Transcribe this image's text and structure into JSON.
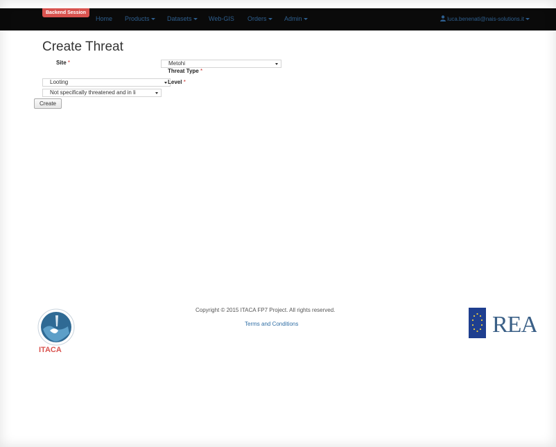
{
  "navbar": {
    "badge": "Backend Session",
    "items": [
      {
        "label": "Home"
      },
      {
        "label": "Products"
      },
      {
        "label": "Datasets"
      },
      {
        "label": "Web-GIS"
      },
      {
        "label": "Orders"
      },
      {
        "label": "Admin"
      }
    ],
    "user": "luca.benenati@nais-solutions.it"
  },
  "page": {
    "title": "Create Threat"
  },
  "form": {
    "site_label": "Site",
    "site_value": "Metohi",
    "threat_type_label": "Threat Type",
    "threat_type_value": "Looting",
    "level_label": "Level",
    "level_value": "Not specifically threatened and in li",
    "required_mark": "*",
    "create_label": "Create"
  },
  "footer": {
    "copyright": "Copyright © 2015 ITACA FP7 Project. All rights reserved.",
    "terms": "Terms and Conditions",
    "itaca_text": "ITACA",
    "rea_text": "REA"
  },
  "colors": {
    "navbar_bg": "#0a0a0a",
    "badge_bg": "#d9534f",
    "nav_link": "#2e5f8f",
    "required": "#c9302c"
  }
}
